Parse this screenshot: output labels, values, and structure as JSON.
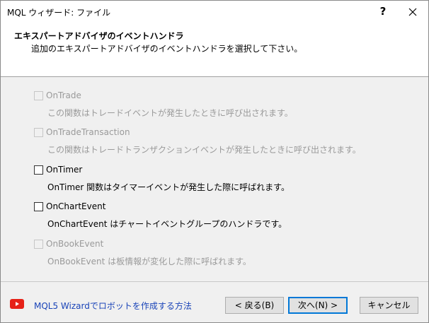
{
  "window": {
    "title": "MQL ウィザード: ファイル",
    "help_label": "?"
  },
  "header": {
    "title": "エキスパートアドバイザのイベントハンドラ",
    "subtitle": "追加のエキスパートアドバイザのイベントハンドラを選択して下さい。"
  },
  "options": [
    {
      "label": "OnTrade",
      "description": "この関数はトレードイベントが発生したときに呼び出されます。",
      "enabled": false,
      "checked": false
    },
    {
      "label": "OnTradeTransaction",
      "description": "この関数はトレードトランザクションイベントが発生したときに呼び出されます。",
      "enabled": false,
      "checked": false
    },
    {
      "label": "OnTimer",
      "description": "OnTimer 関数はタイマーイベントが発生した際に呼ばれます。",
      "enabled": true,
      "checked": false
    },
    {
      "label": "OnChartEvent",
      "description": "OnChartEvent はチャートイベントグループのハンドラです。",
      "enabled": true,
      "checked": false
    },
    {
      "label": "OnBookEvent",
      "description": "OnBookEvent は板情報が変化した際に呼ばれます。",
      "enabled": false,
      "checked": false
    }
  ],
  "footer": {
    "link_text": "MQL5 Wizardでロボットを作成する方法",
    "back_label": "< 戻る(B)",
    "next_label": "次へ(N) >",
    "cancel_label": "キャンセル"
  },
  "colors": {
    "link": "#1a44b8",
    "youtube_red": "#e62117",
    "primary_border": "#0078d7",
    "disabled_text": "#9a9a9a"
  }
}
